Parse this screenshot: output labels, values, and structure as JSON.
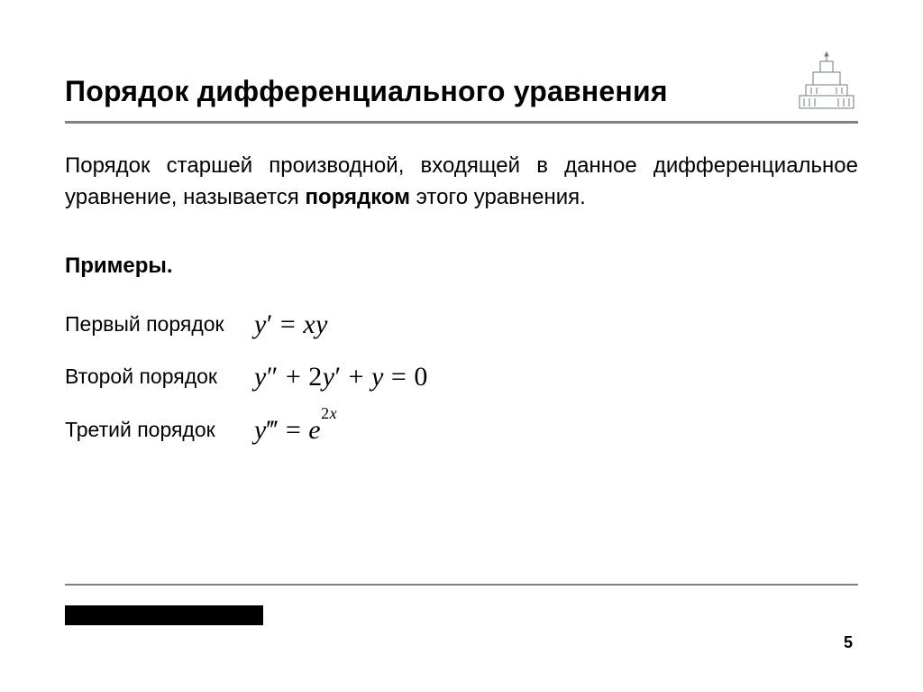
{
  "slide": {
    "title": "Порядок дифференциального уравнения",
    "definition_pre": "Порядок старшей производной, входящей в данное дифференциальное уравнение, называется ",
    "definition_bold": "порядком",
    "definition_post": " этого уравнения.",
    "examples_label": "Примеры",
    "examples": [
      {
        "label": "Первый порядок"
      },
      {
        "label": "Второй порядок"
      },
      {
        "label": "Третий порядок"
      }
    ],
    "page_number": "5"
  },
  "logo": {
    "name": "msu-building-icon"
  }
}
